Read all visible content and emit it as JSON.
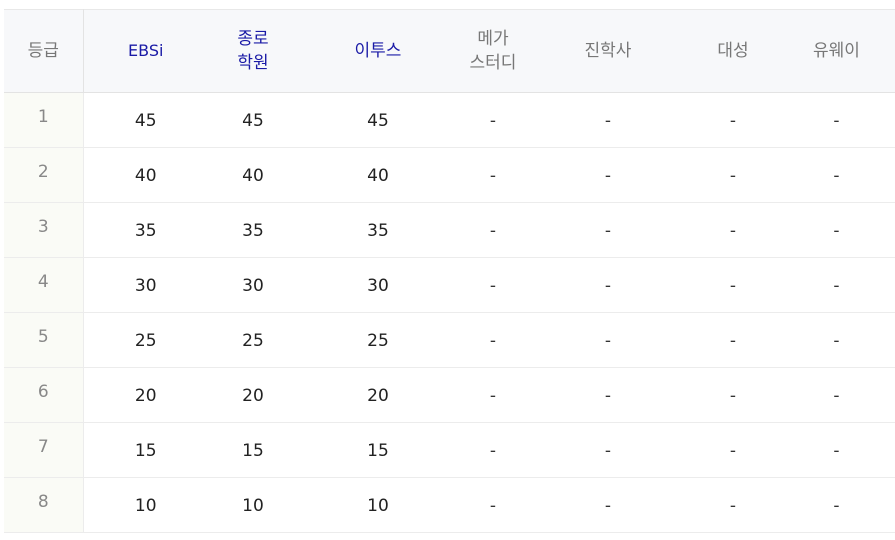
{
  "table": {
    "headers": [
      {
        "key": "grade",
        "lines": [
          "등급"
        ],
        "highlight": false
      },
      {
        "key": "ebsi",
        "lines": [
          "EBSi"
        ],
        "highlight": true
      },
      {
        "key": "jongro",
        "lines": [
          "종로",
          "학원"
        ],
        "highlight": true
      },
      {
        "key": "etoos",
        "lines": [
          "이투스"
        ],
        "highlight": true
      },
      {
        "key": "mega",
        "lines": [
          "메가",
          "스터디"
        ],
        "highlight": false
      },
      {
        "key": "jinhak",
        "lines": [
          "진학사"
        ],
        "highlight": false
      },
      {
        "key": "daesung",
        "lines": [
          "대성"
        ],
        "highlight": false
      },
      {
        "key": "uway",
        "lines": [
          "유웨이"
        ],
        "highlight": false
      }
    ],
    "rows": [
      [
        "1",
        "45",
        "45",
        "45",
        "-",
        "-",
        "-",
        "-"
      ],
      [
        "2",
        "40",
        "40",
        "40",
        "-",
        "-",
        "-",
        "-"
      ],
      [
        "3",
        "35",
        "35",
        "35",
        "-",
        "-",
        "-",
        "-"
      ],
      [
        "4",
        "30",
        "30",
        "30",
        "-",
        "-",
        "-",
        "-"
      ],
      [
        "5",
        "25",
        "25",
        "25",
        "-",
        "-",
        "-",
        "-"
      ],
      [
        "6",
        "20",
        "20",
        "20",
        "-",
        "-",
        "-",
        "-"
      ],
      [
        "7",
        "15",
        "15",
        "15",
        "-",
        "-",
        "-",
        "-"
      ],
      [
        "8",
        "10",
        "10",
        "10",
        "-",
        "-",
        "-",
        "-"
      ]
    ]
  }
}
